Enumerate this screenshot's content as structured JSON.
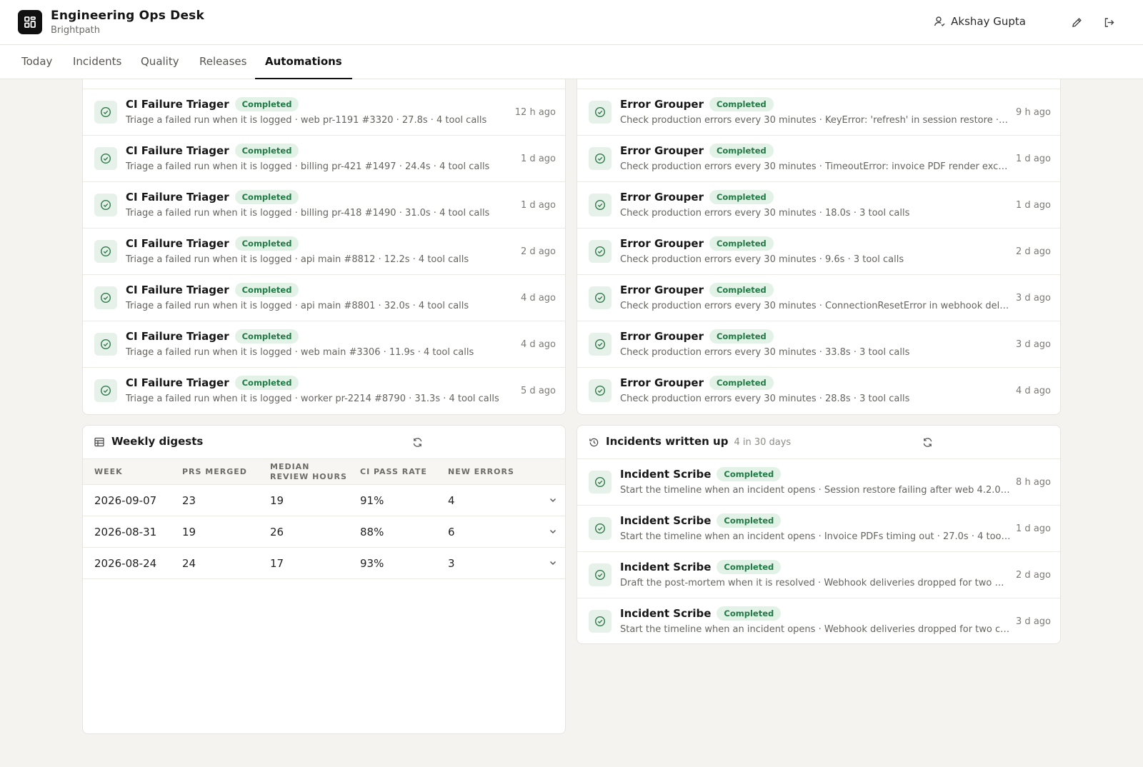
{
  "app": {
    "title": "Engineering Ops Desk",
    "org": "Brightpath"
  },
  "user": {
    "name": "Akshay Gupta"
  },
  "tabs": [
    "Today",
    "Incidents",
    "Quality",
    "Releases",
    "Automations"
  ],
  "active_tab": "Automations",
  "ci_runs": [
    {
      "name": "CI Failure Triager",
      "status": "Completed",
      "desc": "Triage a failed run when it is logged · web pr-1191 #3320 · 27.8s · 4 tool calls",
      "ago": "12 h ago"
    },
    {
      "name": "CI Failure Triager",
      "status": "Completed",
      "desc": "Triage a failed run when it is logged · billing pr-421 #1497 · 24.4s · 4 tool calls",
      "ago": "1 d ago"
    },
    {
      "name": "CI Failure Triager",
      "status": "Completed",
      "desc": "Triage a failed run when it is logged · billing pr-418 #1490 · 31.0s · 4 tool calls",
      "ago": "1 d ago"
    },
    {
      "name": "CI Failure Triager",
      "status": "Completed",
      "desc": "Triage a failed run when it is logged · api main #8812 · 12.2s · 4 tool calls",
      "ago": "2 d ago"
    },
    {
      "name": "CI Failure Triager",
      "status": "Completed",
      "desc": "Triage a failed run when it is logged · api main #8801 · 32.0s · 4 tool calls",
      "ago": "4 d ago"
    },
    {
      "name": "CI Failure Triager",
      "status": "Completed",
      "desc": "Triage a failed run when it is logged · web main #3306 · 11.9s · 4 tool calls",
      "ago": "4 d ago"
    },
    {
      "name": "CI Failure Triager",
      "status": "Completed",
      "desc": "Triage a failed run when it is logged · worker pr-2214 #8790 · 31.3s · 4 tool calls",
      "ago": "5 d ago"
    }
  ],
  "error_runs": [
    {
      "name": "Error Grouper",
      "status": "Completed",
      "desc": "Check production errors every 30 minutes · KeyError: 'refresh' in session restore · …",
      "ago": "9 h ago"
    },
    {
      "name": "Error Grouper",
      "status": "Completed",
      "desc": "Check production errors every 30 minutes · TimeoutError: invoice PDF render exce…",
      "ago": "1 d ago"
    },
    {
      "name": "Error Grouper",
      "status": "Completed",
      "desc": "Check production errors every 30 minutes · 18.0s · 3 tool calls",
      "ago": "1 d ago"
    },
    {
      "name": "Error Grouper",
      "status": "Completed",
      "desc": "Check production errors every 30 minutes · 9.6s · 3 tool calls",
      "ago": "2 d ago"
    },
    {
      "name": "Error Grouper",
      "status": "Completed",
      "desc": "Check production errors every 30 minutes · ConnectionResetError in webhook del…",
      "ago": "3 d ago"
    },
    {
      "name": "Error Grouper",
      "status": "Completed",
      "desc": "Check production errors every 30 minutes · 33.8s · 3 tool calls",
      "ago": "3 d ago"
    },
    {
      "name": "Error Grouper",
      "status": "Completed",
      "desc": "Check production errors every 30 minutes · 28.8s · 3 tool calls",
      "ago": "4 d ago"
    }
  ],
  "weekly": {
    "title": "Weekly digests",
    "columns": [
      "WEEK",
      "PRS MERGED",
      "MEDIAN REVIEW HOURS",
      "CI PASS RATE",
      "NEW ERRORS"
    ],
    "rows": [
      [
        "2026-09-07",
        "23",
        "19",
        "91%",
        "4"
      ],
      [
        "2026-08-31",
        "19",
        "26",
        "88%",
        "6"
      ],
      [
        "2026-08-24",
        "24",
        "17",
        "93%",
        "3"
      ]
    ]
  },
  "incidents": {
    "title": "Incidents written up",
    "subtitle": "4 in 30 days",
    "runs": [
      {
        "name": "Incident Scribe",
        "status": "Completed",
        "desc": "Start the timeline when an incident opens · Session restore failing after web 4.2.0 …",
        "ago": "8 h ago"
      },
      {
        "name": "Incident Scribe",
        "status": "Completed",
        "desc": "Start the timeline when an incident opens · Invoice PDFs timing out · 27.0s · 4 tool …",
        "ago": "1 d ago"
      },
      {
        "name": "Incident Scribe",
        "status": "Completed",
        "desc": "Draft the post-mortem when it is resolved · Webhook deliveries dropped for two …",
        "ago": "2 d ago"
      },
      {
        "name": "Incident Scribe",
        "status": "Completed",
        "desc": "Start the timeline when an incident opens · Webhook deliveries dropped for two c…",
        "ago": "3 d ago"
      }
    ]
  }
}
